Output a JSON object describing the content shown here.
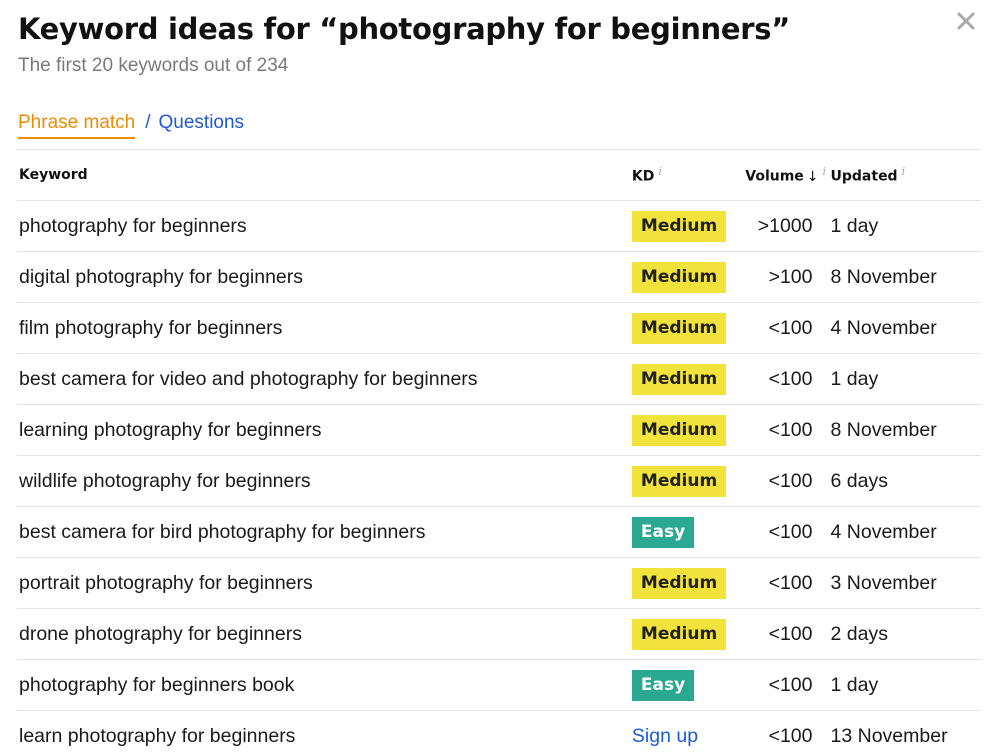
{
  "header": {
    "title": "Keyword ideas for “photography for beginners”",
    "subtitle": "The first 20 keywords out of 234"
  },
  "tabs": {
    "active": "Phrase match",
    "separator": "/",
    "other": "Questions"
  },
  "table": {
    "columns": {
      "keyword": "Keyword",
      "kd": "KD",
      "volume": "Volume",
      "updated": "Updated",
      "info_glyph": "i",
      "sort_arrow": "↓"
    },
    "rows": [
      {
        "keyword": "photography for beginners",
        "kd": "Medium",
        "kd_type": "medium",
        "volume": ">1000",
        "updated": "1 day"
      },
      {
        "keyword": "digital photography for beginners",
        "kd": "Medium",
        "kd_type": "medium",
        "volume": ">100",
        "updated": "8 November"
      },
      {
        "keyword": "film photography for beginners",
        "kd": "Medium",
        "kd_type": "medium",
        "volume": "<100",
        "updated": "4 November"
      },
      {
        "keyword": "best camera for video and photography for beginners",
        "kd": "Medium",
        "kd_type": "medium",
        "volume": "<100",
        "updated": "1 day"
      },
      {
        "keyword": "learning photography for beginners",
        "kd": "Medium",
        "kd_type": "medium",
        "volume": "<100",
        "updated": "8 November"
      },
      {
        "keyword": "wildlife photography for beginners",
        "kd": "Medium",
        "kd_type": "medium",
        "volume": "<100",
        "updated": "6 days"
      },
      {
        "keyword": "best camera for bird photography for beginners",
        "kd": "Easy",
        "kd_type": "easy",
        "volume": "<100",
        "updated": "4 November"
      },
      {
        "keyword": "portrait photography for beginners",
        "kd": "Medium",
        "kd_type": "medium",
        "volume": "<100",
        "updated": "3 November"
      },
      {
        "keyword": "drone photography for beginners",
        "kd": "Medium",
        "kd_type": "medium",
        "volume": "<100",
        "updated": "2 days"
      },
      {
        "keyword": "photography for beginners book",
        "kd": "Easy",
        "kd_type": "easy",
        "volume": "<100",
        "updated": "1 day"
      },
      {
        "keyword": "learn photography for beginners",
        "kd": "Sign up",
        "kd_type": "signup",
        "volume": "<100",
        "updated": "13 November"
      }
    ]
  },
  "colors": {
    "accent_orange": "#f08a00",
    "link_blue": "#1d5bd6",
    "medium_badge": "#f1e23c",
    "easy_badge": "#2aa891"
  },
  "icons": {
    "close": "close-icon"
  }
}
